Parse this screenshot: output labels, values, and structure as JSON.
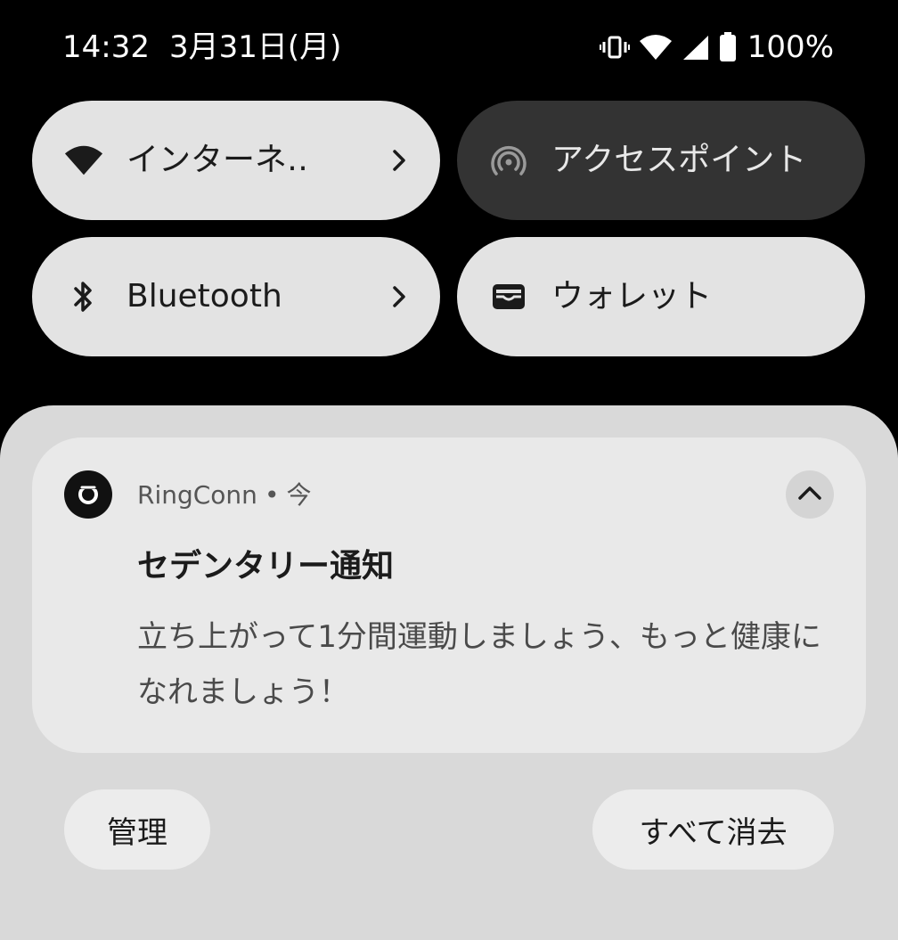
{
  "status_bar": {
    "time": "14:32",
    "date": "3月31日(月)",
    "battery_percent": "100%",
    "icons": [
      "vibrate-icon",
      "wifi-icon",
      "cell-signal-icon",
      "battery-icon"
    ]
  },
  "quick_settings": {
    "tiles": [
      {
        "label": "インターネ‥",
        "icon": "wifi-icon",
        "has_chevron": true,
        "active": true
      },
      {
        "label": "アクセスポイント",
        "icon": "hotspot-icon",
        "has_chevron": false,
        "active": false
      },
      {
        "label": "Bluetooth",
        "icon": "bluetooth-icon",
        "has_chevron": true,
        "active": true
      },
      {
        "label": "ウォレット",
        "icon": "wallet-icon",
        "has_chevron": false,
        "active": true
      }
    ]
  },
  "notification": {
    "app_name": "RingConn",
    "separator": "•",
    "time": "今",
    "title": "セデンタリー通知",
    "body": "立ち上がって1分間運動しましょう、もっと健康になれましょう！"
  },
  "footer": {
    "manage_label": "管理",
    "clear_all_label": "すべて消去"
  },
  "colors": {
    "background": "#000000",
    "tile_active": "#e3e3e3",
    "tile_inactive": "#333333",
    "shade": "#d9d9d9",
    "card": "#e9e9e9"
  }
}
